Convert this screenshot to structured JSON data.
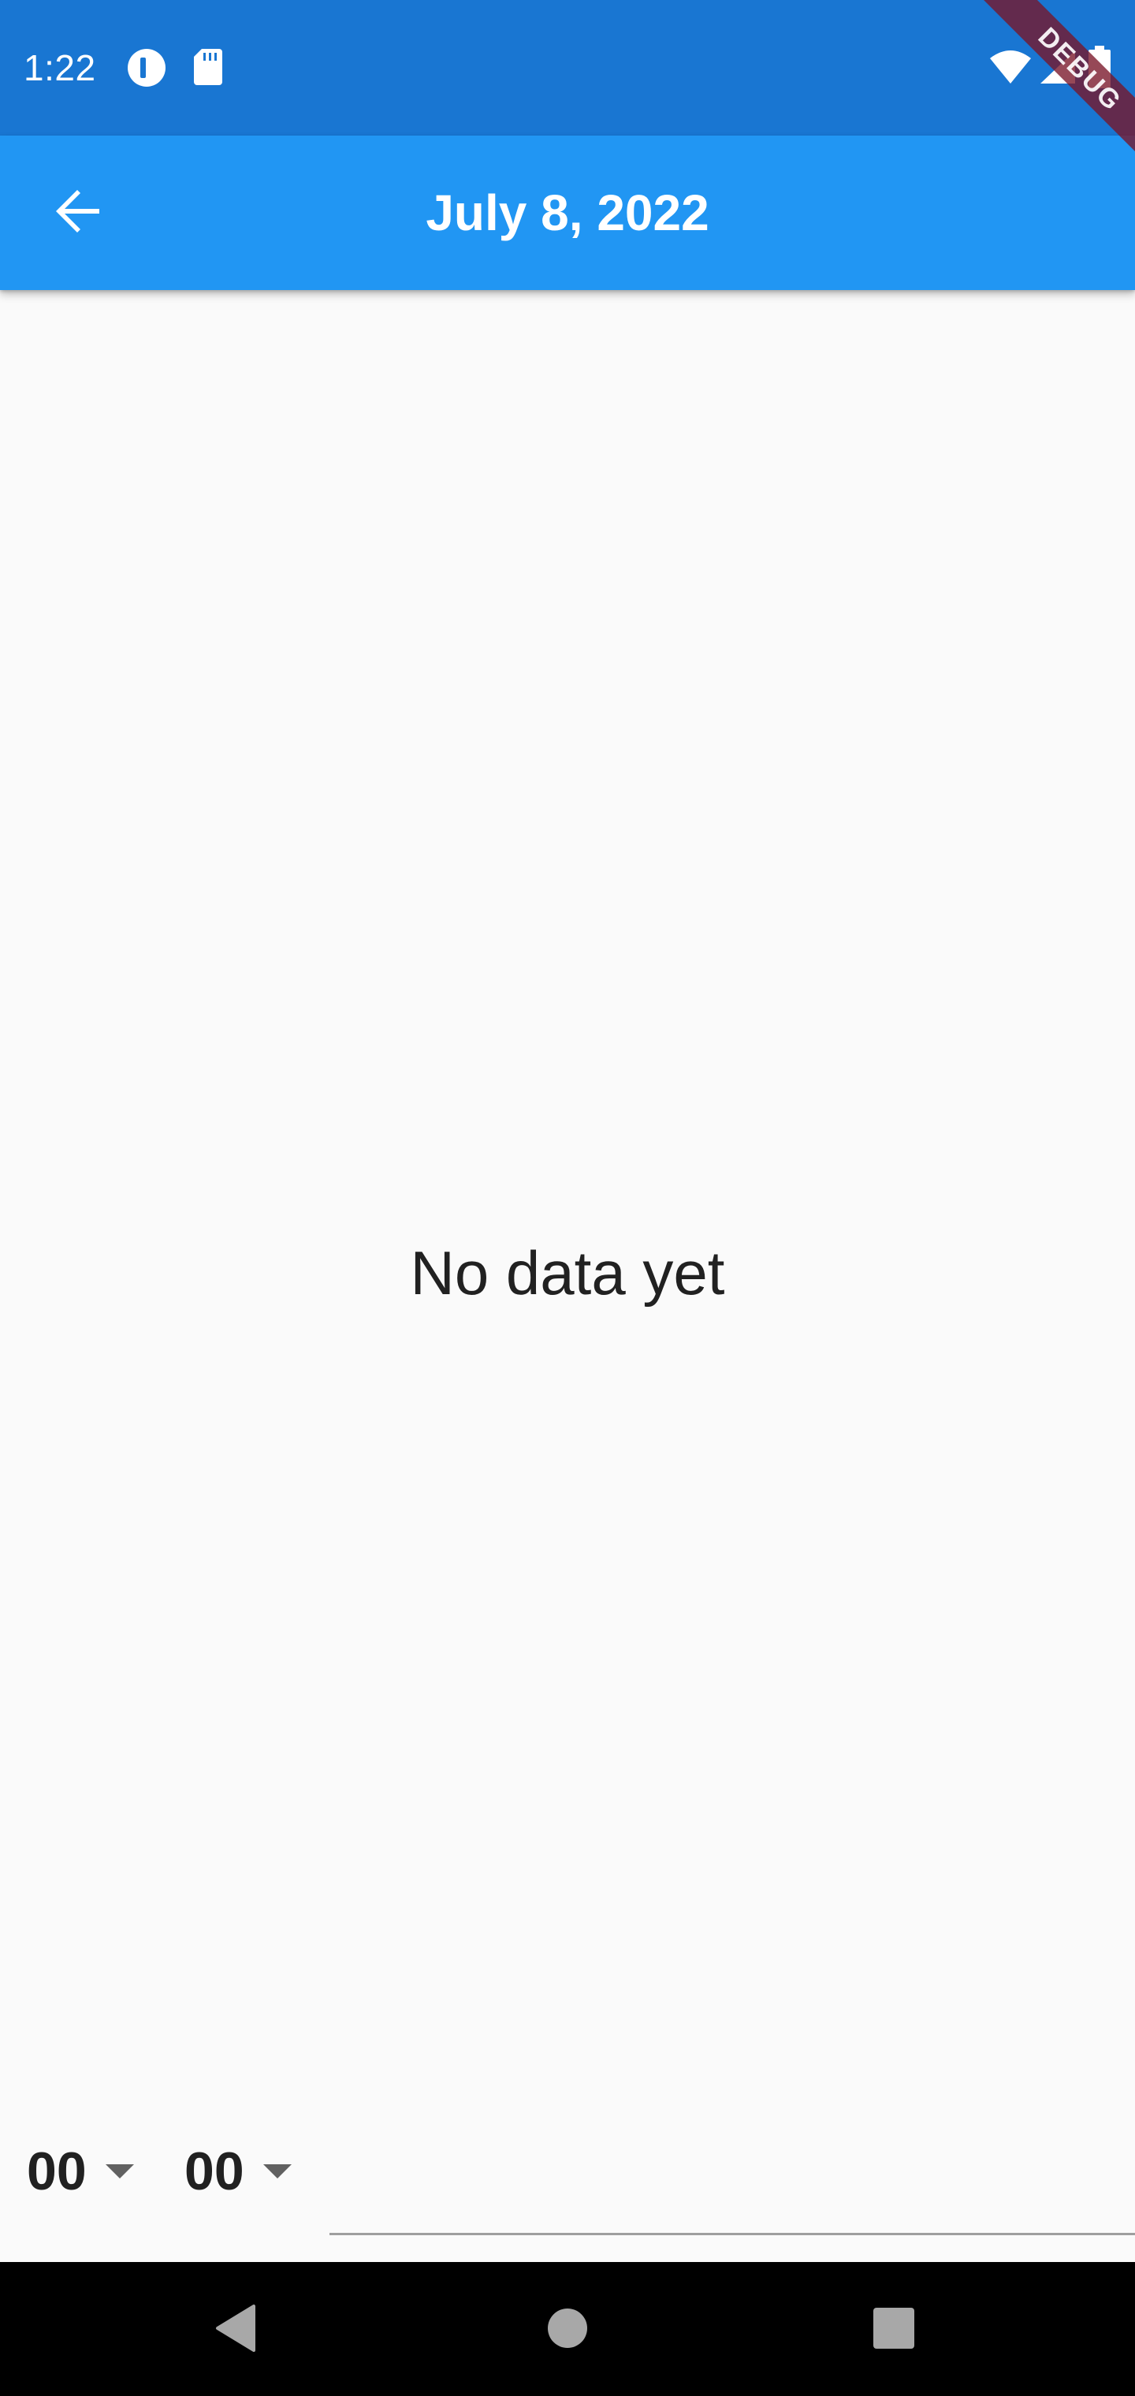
{
  "status_bar": {
    "time": "1:22",
    "icons": [
      "data-saver-icon",
      "sd-card-icon",
      "wifi-icon",
      "signal-icon",
      "battery-icon"
    ],
    "background": "#1976d2"
  },
  "app_bar": {
    "title": "July 8, 2022",
    "back_icon": "arrow-back-icon",
    "background": "#2196f3"
  },
  "debug_banner": {
    "label": "DEBUG"
  },
  "main": {
    "empty_message": "No data yet"
  },
  "bottom_controls": {
    "hour_value": "00",
    "minute_value": "00",
    "note_value": ""
  },
  "nav_bar": {
    "icons": [
      "back-triangle-icon",
      "home-circle-icon",
      "recents-square-icon"
    ]
  }
}
